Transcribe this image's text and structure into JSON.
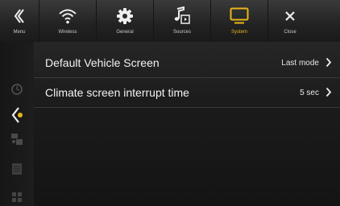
{
  "topbar": {
    "items": [
      {
        "label": "Menu",
        "icon": "chevron-left-double-icon"
      },
      {
        "label": "Wireless",
        "icon": "wifi-icon"
      },
      {
        "label": "General",
        "icon": "gear-icon"
      },
      {
        "label": "Sources",
        "icon": "music-note-icon"
      },
      {
        "label": "System",
        "icon": "monitor-icon",
        "active": true
      },
      {
        "label": "Close",
        "icon": "close-icon"
      }
    ],
    "accent_color": "#e8b51c"
  },
  "settings": {
    "rows": [
      {
        "label": "Default Vehicle Screen",
        "value": "Last mode"
      },
      {
        "label": "Climate screen interrupt time",
        "value": "5 sec"
      }
    ]
  },
  "rail": {
    "icons": [
      "clock-icon",
      "back-arrow-icon",
      "car-settings-icon",
      "grid-list-icon",
      "apps-icon"
    ]
  }
}
